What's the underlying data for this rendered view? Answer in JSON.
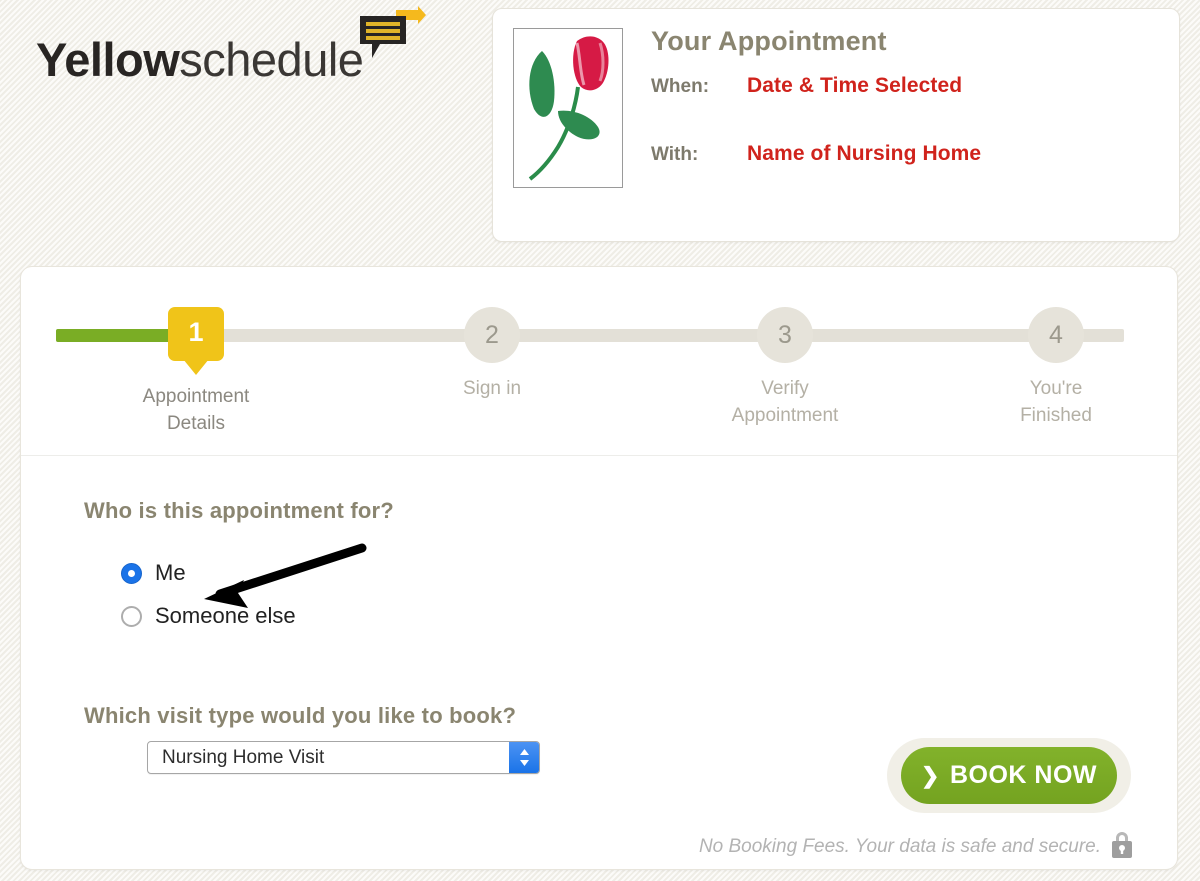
{
  "brand": {
    "name_bold": "Yellow",
    "name_light": "schedule",
    "logo_icon": "speech-bubble-arrow-icon",
    "accent_yellow": "#f0c419",
    "accent_green": "#7aad25"
  },
  "appointment_card": {
    "title": "Your Appointment",
    "thumbnail_icon": "tulip-flower-image",
    "rows": [
      {
        "label": "When:",
        "value": "Date & Time Selected"
      },
      {
        "label": "With:",
        "value": "Name of Nursing Home"
      }
    ],
    "value_color": "#d0231c"
  },
  "steps": {
    "current": 1,
    "progress_percent": 13,
    "items": [
      {
        "number": "1",
        "label": "Appointment\nDetails",
        "state": "active"
      },
      {
        "number": "2",
        "label": "Sign in",
        "state": "upcoming"
      },
      {
        "number": "3",
        "label": "Verify\nAppointment",
        "state": "upcoming"
      },
      {
        "number": "4",
        "label": "You're\nFinished",
        "state": "upcoming"
      }
    ]
  },
  "form": {
    "who_question": "Who is this appointment for?",
    "who_options": [
      {
        "label": "Me",
        "selected": true
      },
      {
        "label": "Someone else",
        "selected": false
      }
    ],
    "visit_question": "Which visit type would you like to book?",
    "visit_select": {
      "value": "Nursing Home Visit",
      "stepper_icon": "chevron-up-down-icon"
    },
    "book_button": {
      "label": "BOOK NOW",
      "chevron_icon": "chevron-right-icon"
    },
    "footnote": "No Booking Fees. Your data is safe and secure.",
    "footnote_icon": "padlock-icon"
  },
  "annotation": {
    "arrow_icon": "pointer-arrow-icon",
    "points_to": "Me"
  }
}
